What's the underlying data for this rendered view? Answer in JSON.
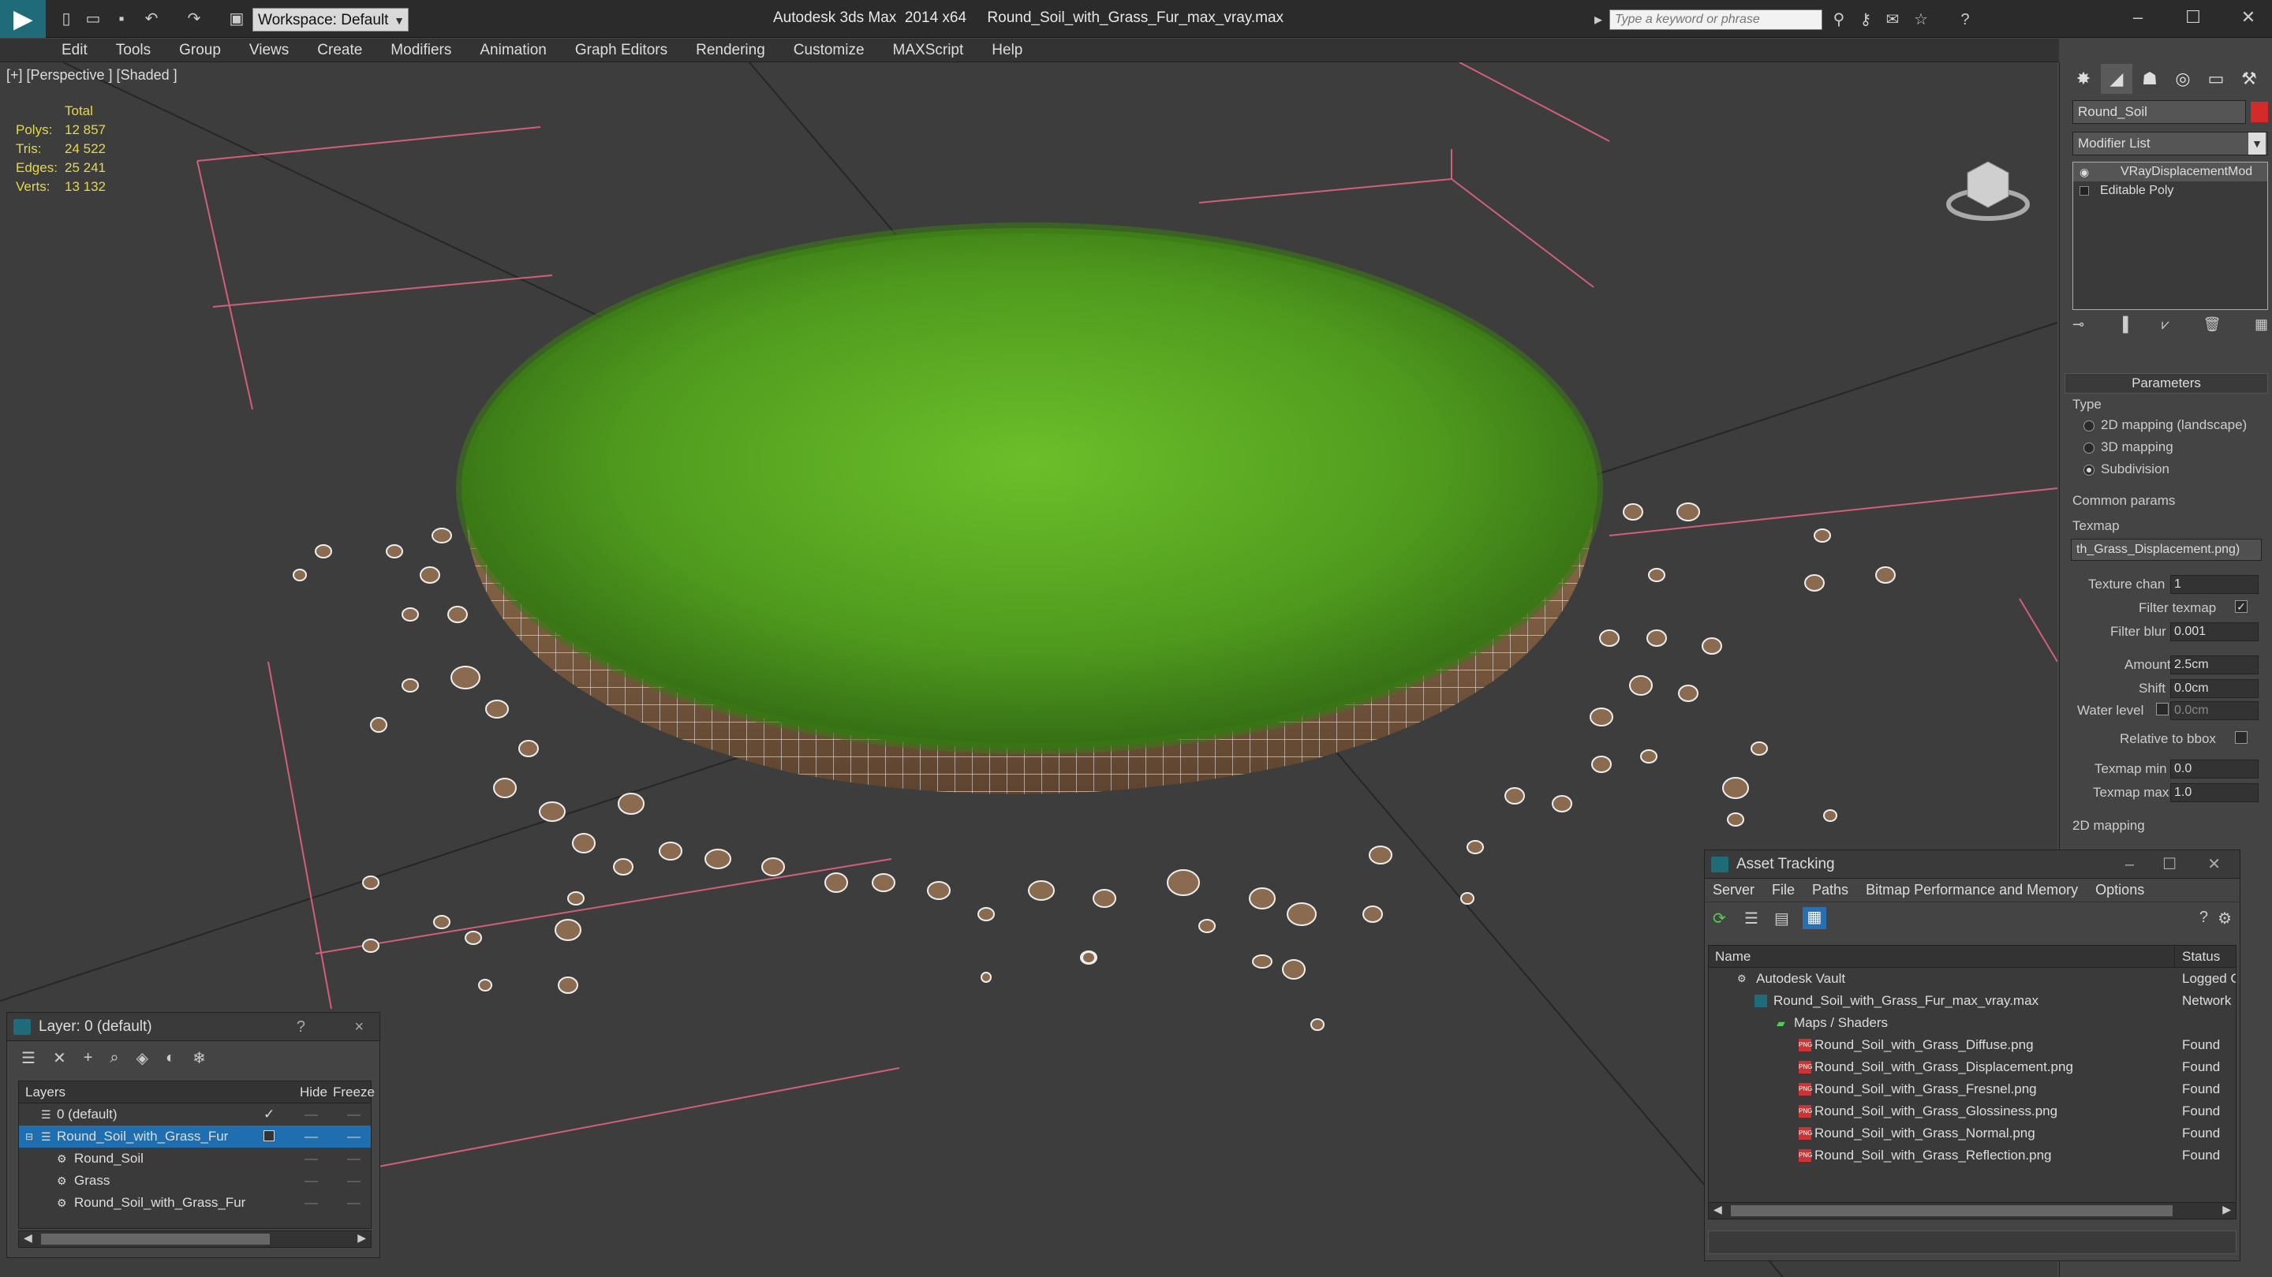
{
  "app": {
    "title": "Autodesk 3ds Max  2014 x64     Round_Soil_with_Grass_Fur_max_vray.max",
    "workspace": "Workspace: Default",
    "search_placeholder": "Type a keyword or phrase",
    "logo_icon": "3dsmax-logo-icon"
  },
  "menu": [
    "Edit",
    "Tools",
    "Group",
    "Views",
    "Create",
    "Modifiers",
    "Animation",
    "Graph Editors",
    "Rendering",
    "Customize",
    "MAXScript",
    "Help"
  ],
  "viewport": {
    "label": "[+] [Perspective ] [Shaded ]",
    "stats_header": "Total",
    "stats": [
      {
        "label": "Polys:",
        "value": "12 857"
      },
      {
        "label": "Tris:",
        "value": "24 522"
      },
      {
        "label": "Edges:",
        "value": "25 241"
      },
      {
        "label": "Verts:",
        "value": "13 132"
      }
    ]
  },
  "command_panel": {
    "object_name": "Round_Soil",
    "object_color": "#d42a2a",
    "modifier_list": "Modifier List",
    "stack": [
      "VRayDisplacementMod",
      "Editable Poly"
    ],
    "rollout_title": "Parameters",
    "type_label": "Type",
    "type_options": [
      {
        "label": "2D mapping (landscape)",
        "selected": false
      },
      {
        "label": "3D mapping",
        "selected": false
      },
      {
        "label": "Subdivision",
        "selected": true
      }
    ],
    "common_params": "Common params",
    "texmap_label": "Texmap",
    "texmap_value": "th_Grass_Displacement.png)",
    "texture_chan_label": "Texture chan",
    "texture_chan_value": "1",
    "filter_texmap_label": "Filter texmap",
    "filter_blur_label": "Filter blur",
    "filter_blur_value": "0.001",
    "amount_label": "Amount",
    "amount_value": "2.5cm",
    "shift_label": "Shift",
    "shift_value": "0.0cm",
    "water_level_label": "Water level",
    "water_level_value": "0.0cm",
    "relative_bbox_label": "Relative to bbox",
    "texmap_min_label": "Texmap min",
    "texmap_min_value": "0.0",
    "texmap_max_label": "Texmap max",
    "texmap_max_value": "1.0",
    "mapping_2d_label": "2D mapping"
  },
  "layer_window": {
    "title": "Layer: 0 (default)",
    "help": "?",
    "close": "×",
    "col_layers": "Layers",
    "col_hide": "Hide",
    "col_freeze": "Freeze",
    "rows": [
      {
        "name": "0 (default)",
        "indent": 1,
        "selected": false
      },
      {
        "name": "Round_Soil_with_Grass_Fur",
        "indent": 1,
        "selected": true
      },
      {
        "name": "Round_Soil",
        "indent": 2,
        "selected": false
      },
      {
        "name": "Grass",
        "indent": 2,
        "selected": false
      },
      {
        "name": "Round_Soil_with_Grass_Fur",
        "indent": 2,
        "selected": false
      }
    ]
  },
  "asset_window": {
    "title": "Asset Tracking",
    "menu": [
      "Server",
      "File",
      "Paths",
      "Bitmap Performance and Memory",
      "Options"
    ],
    "col_name": "Name",
    "col_status": "Status",
    "rows": [
      {
        "name": "Autodesk Vault",
        "status": "Logged O",
        "indent": 1,
        "icon": "vault-icon"
      },
      {
        "name": "Round_Soil_with_Grass_Fur_max_vray.max",
        "status": "Network I",
        "indent": 2,
        "icon": "max-file-icon"
      },
      {
        "name": "Maps / Shaders",
        "status": "",
        "indent": 3,
        "icon": "maps-folder-icon"
      },
      {
        "name": "Round_Soil_with_Grass_Diffuse.png",
        "status": "Found",
        "indent": 4,
        "icon": "png-file-icon"
      },
      {
        "name": "Round_Soil_with_Grass_Displacement.png",
        "status": "Found",
        "indent": 4,
        "icon": "png-file-icon"
      },
      {
        "name": "Round_Soil_with_Grass_Fresnel.png",
        "status": "Found",
        "indent": 4,
        "icon": "png-file-icon"
      },
      {
        "name": "Round_Soil_with_Grass_Glossiness.png",
        "status": "Found",
        "indent": 4,
        "icon": "png-file-icon"
      },
      {
        "name": "Round_Soil_with_Grass_Normal.png",
        "status": "Found",
        "indent": 4,
        "icon": "png-file-icon"
      },
      {
        "name": "Round_Soil_with_Grass_Reflection.png",
        "status": "Found",
        "indent": 4,
        "icon": "png-file-icon"
      }
    ]
  }
}
